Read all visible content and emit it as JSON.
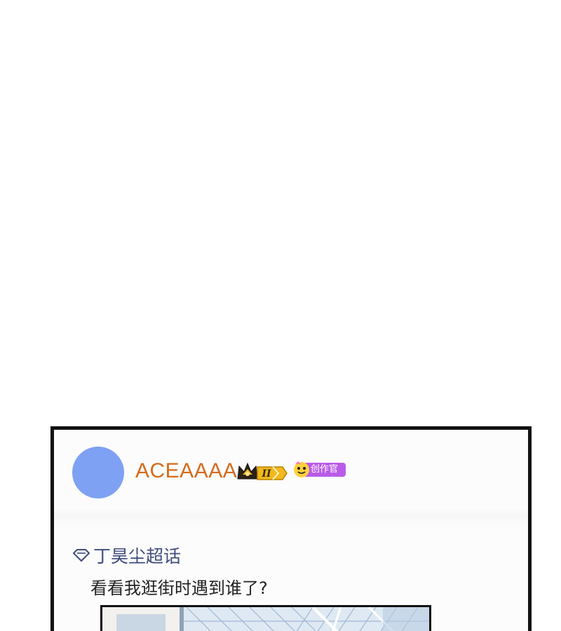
{
  "post": {
    "username": "ACEAAAA",
    "level_badge": "II",
    "creator_badge": "创作官",
    "topic": "丁昊尘超话",
    "text": "看看我逛街时遇到谁了?"
  },
  "icons": {
    "avatar": "avatar",
    "crown": "crown-icon",
    "creator": "creator-icon",
    "topic": "diamond-icon"
  },
  "colors": {
    "avatar": "#7ea1f3",
    "username": "#d56b1d",
    "topic": "#3f4b7c",
    "creator_badge": "#b95be8",
    "crown_gold": "#f2b81d"
  }
}
